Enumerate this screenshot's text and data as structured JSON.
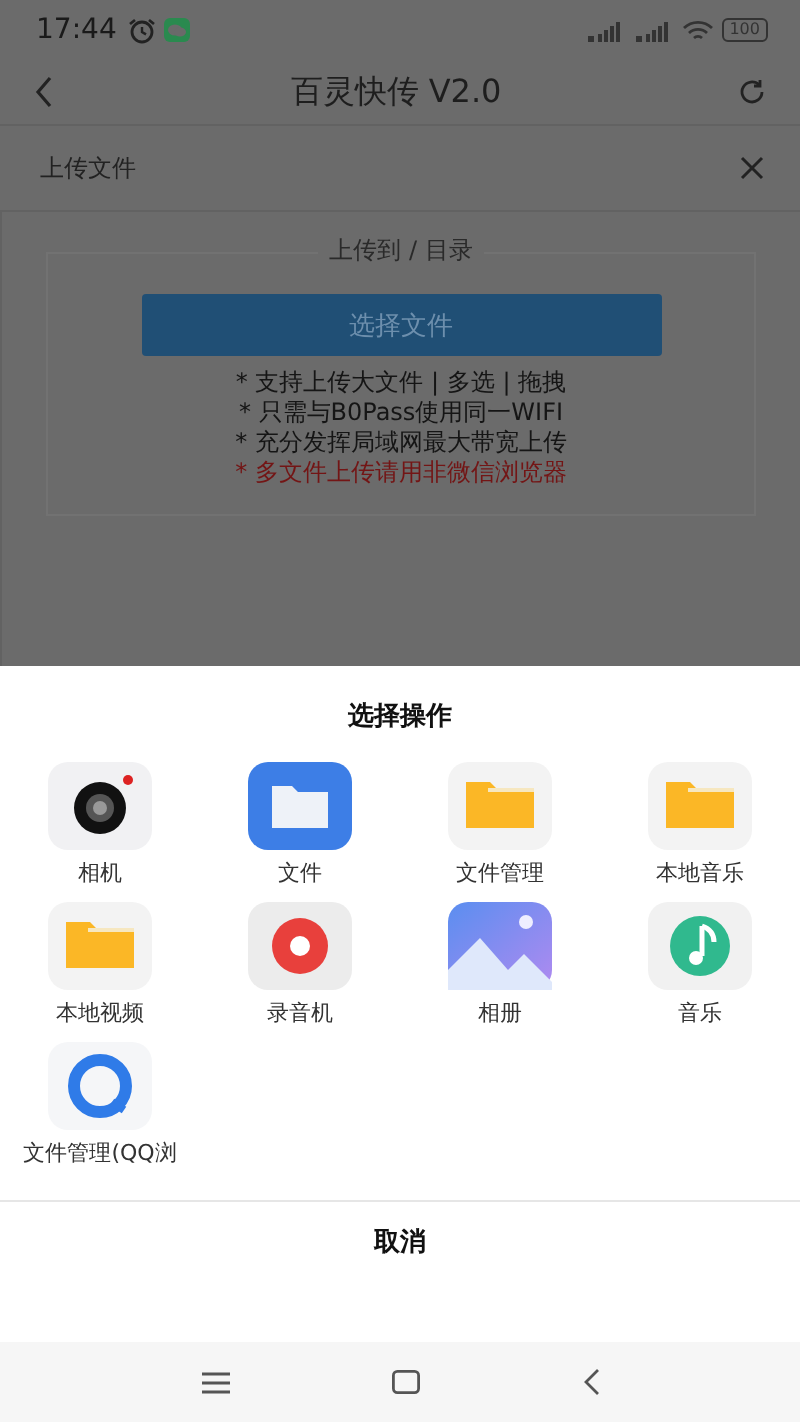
{
  "status_bar": {
    "time": "17:44",
    "battery": "100"
  },
  "header": {
    "title": "百灵快传 V2.0"
  },
  "upload_panel": {
    "title": "上传文件",
    "target": "上传到 / 目录",
    "button": "选择文件",
    "notes": [
      {
        "text": "* 支持上传大文件 | 多选 | 拖拽",
        "warning": false
      },
      {
        "text": "* 只需与B0Pass使用同一WIFI",
        "warning": false
      },
      {
        "text": "* 充分发挥局域网最大带宽上传",
        "warning": false
      },
      {
        "text": "* 多文件上传请用非微信浏览器",
        "warning": true
      }
    ]
  },
  "sheet": {
    "title": "选择操作",
    "apps": [
      {
        "label": "相机",
        "kind": "camera"
      },
      {
        "label": "文件",
        "kind": "files"
      },
      {
        "label": "文件管理",
        "kind": "folder"
      },
      {
        "label": "本地音乐",
        "kind": "folder"
      },
      {
        "label": "本地视频",
        "kind": "folder"
      },
      {
        "label": "录音机",
        "kind": "recorder"
      },
      {
        "label": "相册",
        "kind": "gallery"
      },
      {
        "label": "音乐",
        "kind": "music"
      },
      {
        "label": "文件管理(QQ浏",
        "kind": "browser"
      }
    ],
    "cancel": "取消"
  }
}
